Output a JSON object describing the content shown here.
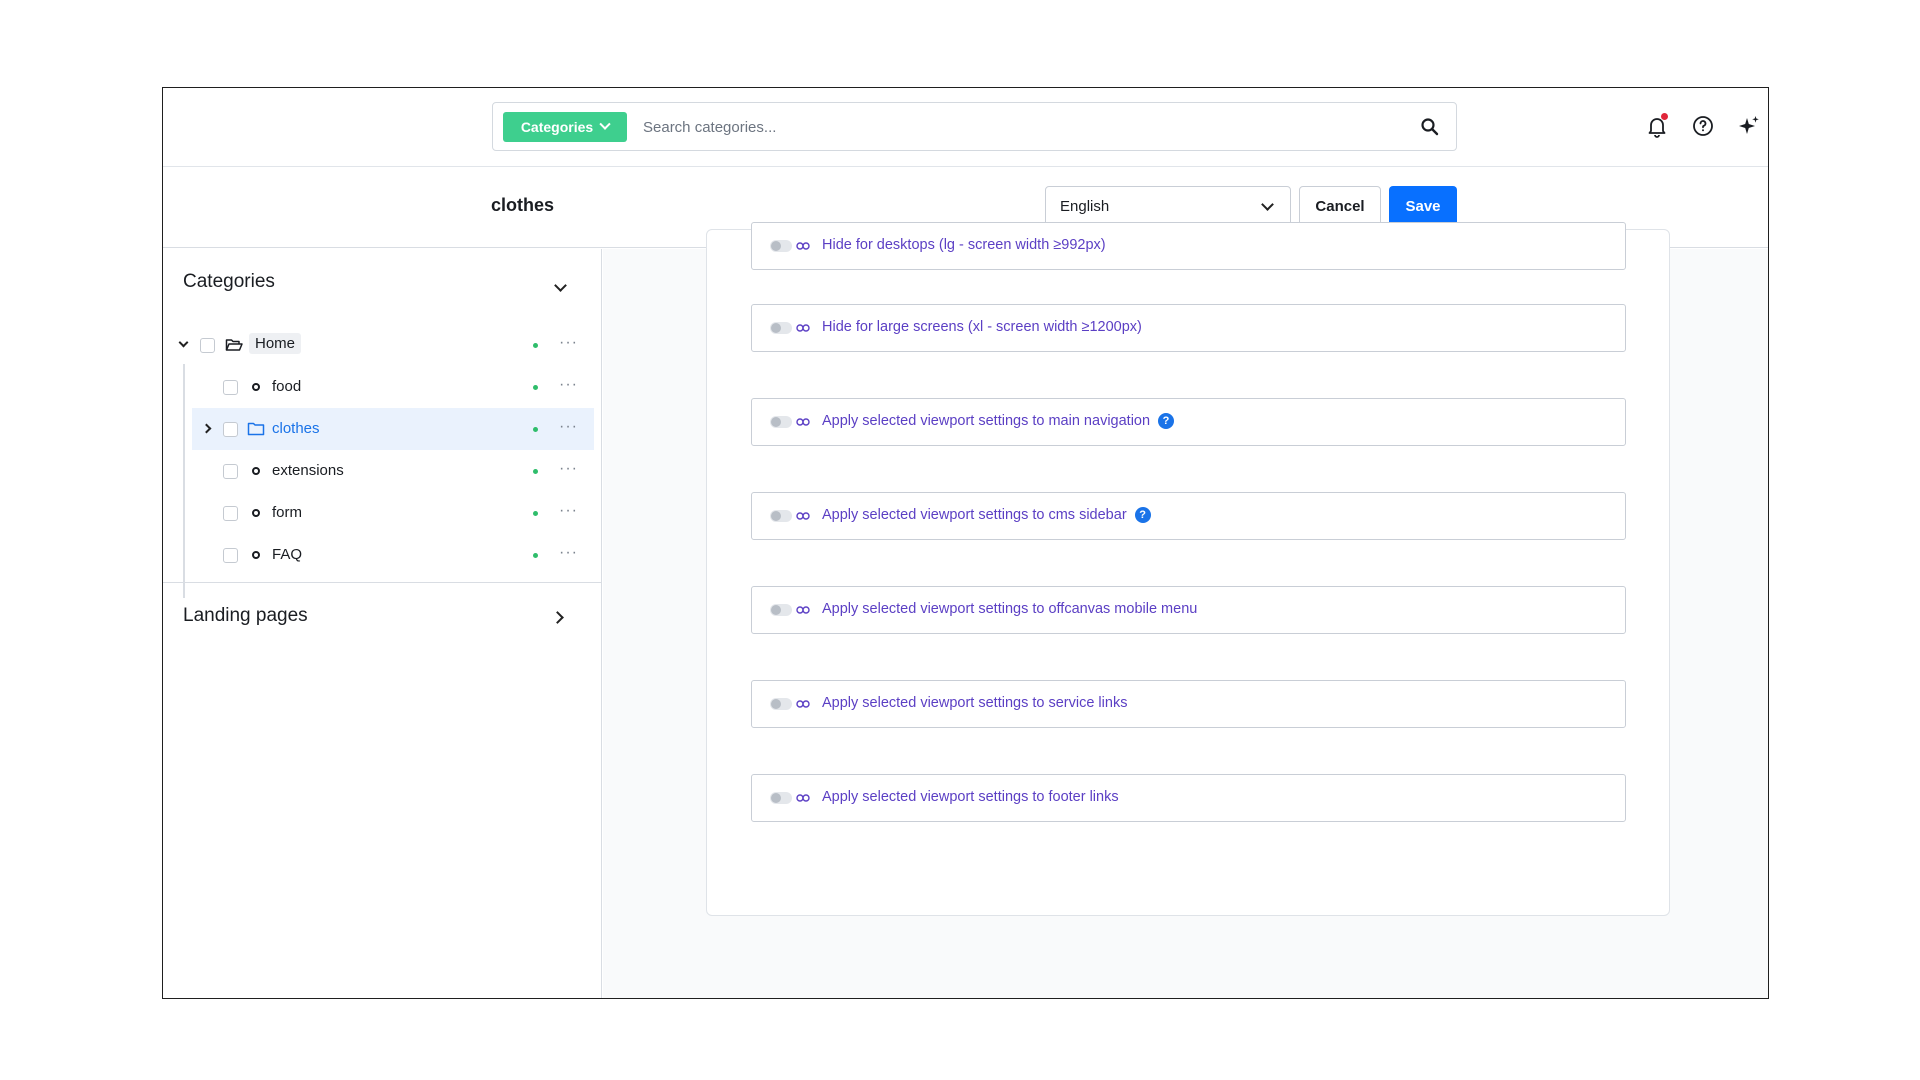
{
  "topbar": {
    "category_pill": "Categories",
    "search_placeholder": "Search categories..."
  },
  "header": {
    "title": "clothes",
    "language": "English",
    "cancel_label": "Cancel",
    "save_label": "Save"
  },
  "sidebar": {
    "title": "Categories",
    "tree": [
      {
        "label": "Home",
        "icon": "folder-open-icon"
      },
      {
        "label": "food",
        "icon": "leaf-dot-icon"
      },
      {
        "label": "clothes",
        "icon": "folder-icon",
        "selected": true
      },
      {
        "label": "extensions",
        "icon": "leaf-dot-icon"
      },
      {
        "label": "form",
        "icon": "leaf-dot-icon"
      },
      {
        "label": "FAQ",
        "icon": "leaf-dot-icon"
      }
    ],
    "landing_pages": "Landing pages"
  },
  "settings": [
    {
      "label": "Hide for desktops (lg - screen width ≥992px)"
    },
    {
      "label": "Hide for large screens (xl - screen width ≥1200px)"
    },
    {
      "label": "Apply selected viewport settings to main navigation",
      "help": true
    },
    {
      "label": "Apply selected viewport settings to cms sidebar",
      "help": true
    },
    {
      "label": "Apply selected viewport settings to offcanvas mobile menu"
    },
    {
      "label": "Apply selected viewport settings to service links"
    },
    {
      "label": "Apply selected viewport settings to footer links"
    }
  ],
  "help_glyph": "?",
  "colors": {
    "accent_green": "#3ecf8e",
    "primary_blue": "#0870ff",
    "setting_text": "#5b3fc4",
    "status_green": "#2fbd6b",
    "notification_red": "#e0263a"
  }
}
